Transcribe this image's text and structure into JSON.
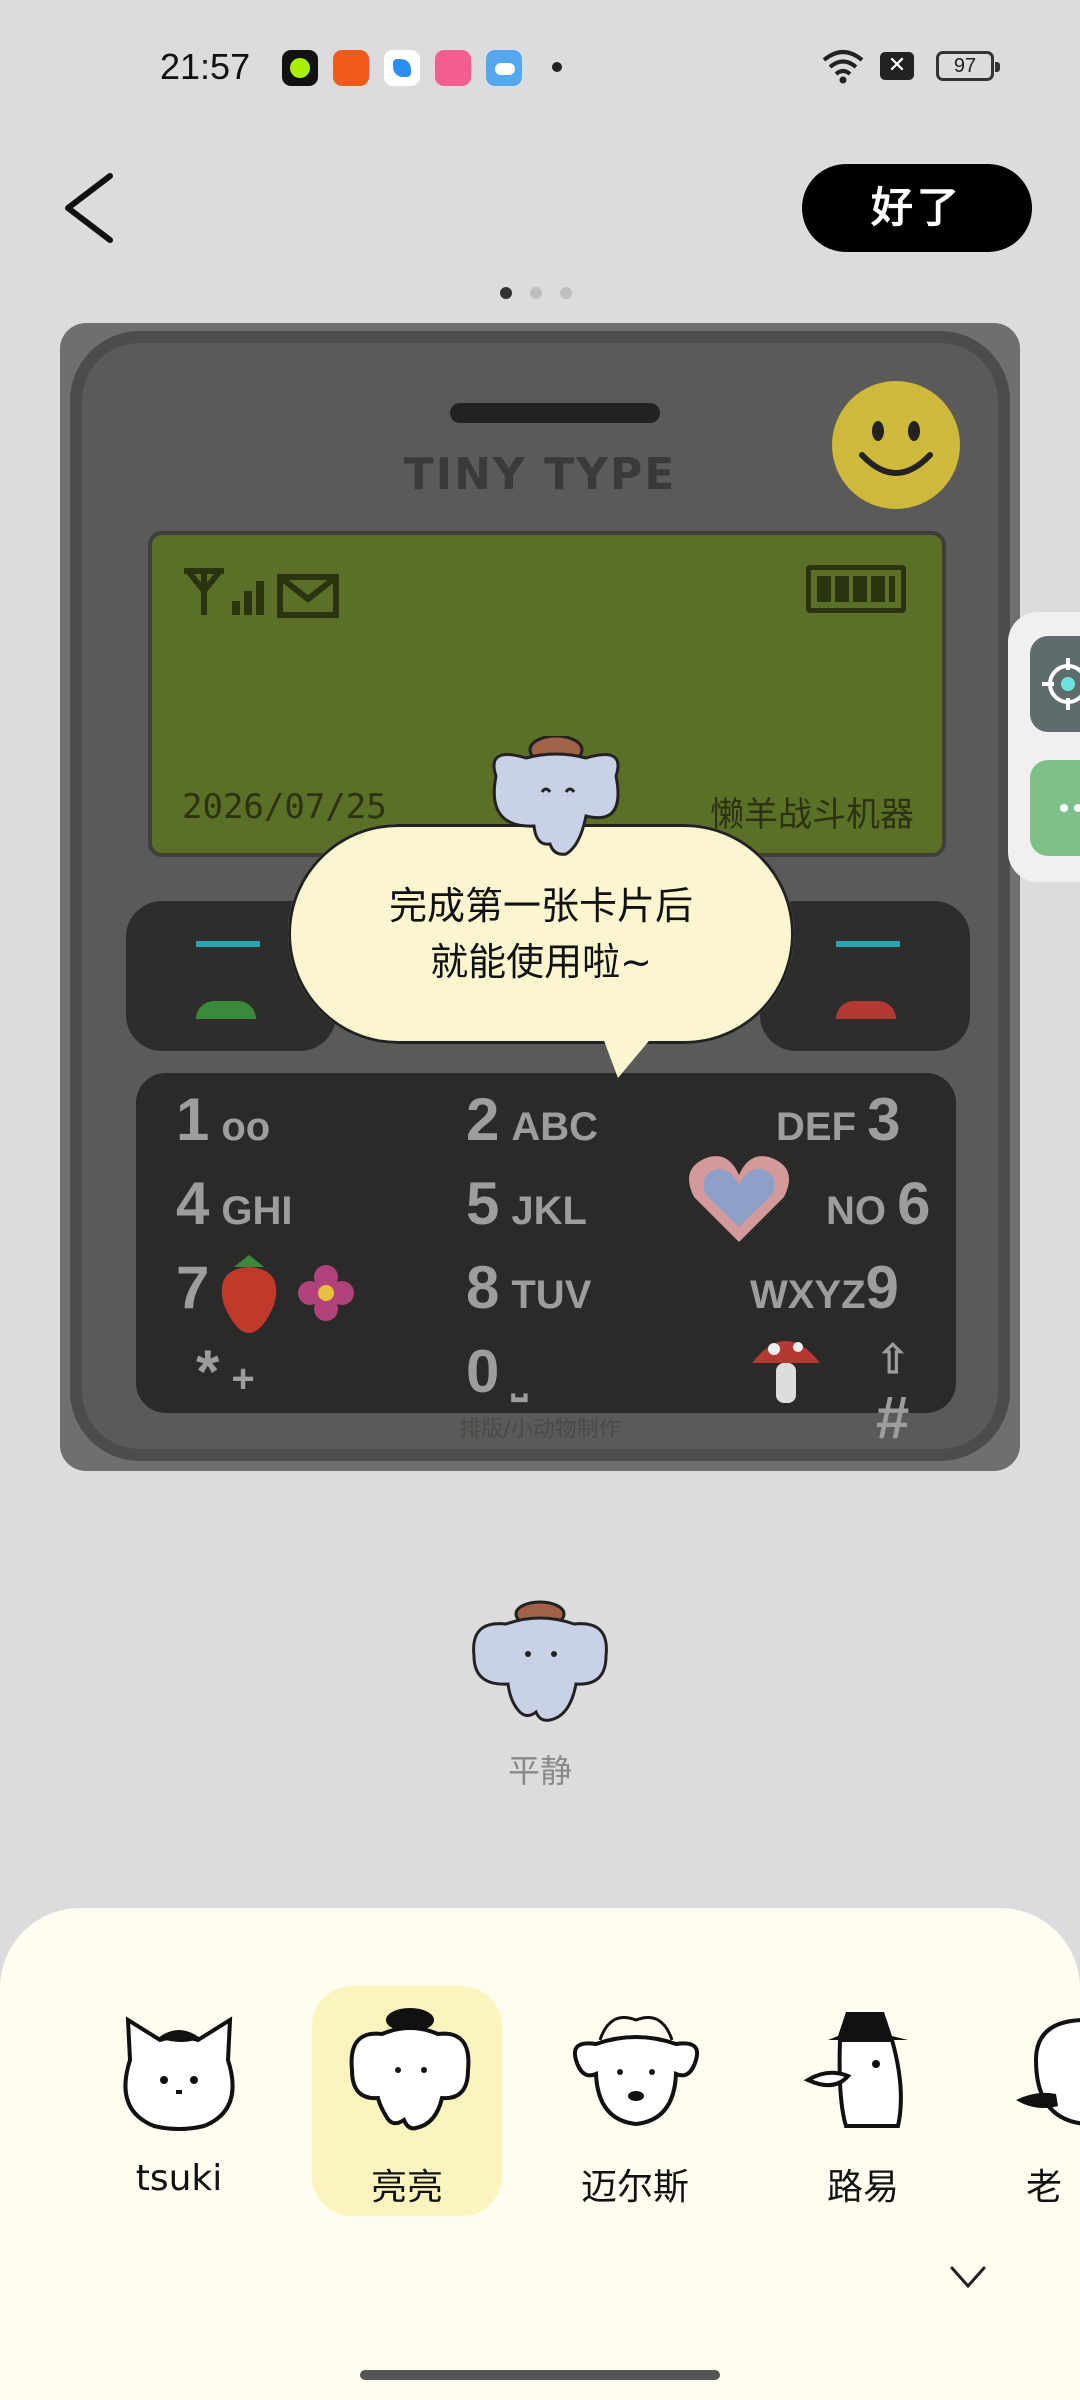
{
  "status_bar": {
    "time": "21:57",
    "battery": "97",
    "app_icons": [
      "green-dot-app-icon",
      "kuaishou-app-icon",
      "browser-app-icon",
      "bilibili-app-icon",
      "weather-app-icon"
    ]
  },
  "header": {
    "done_label": "好了",
    "pager_count": 3,
    "pager_active": 0
  },
  "preview": {
    "brand": "TINY TYPE",
    "date": "2026/07/25",
    "device_name": "懒羊战斗机器",
    "credit": "排版/小动物制作",
    "keys": [
      {
        "num": "1",
        "letters": ""
      },
      {
        "num": "2",
        "letters": "ABC"
      },
      {
        "num": "3",
        "letters": "DEF"
      },
      {
        "num": "4",
        "letters": "GHI"
      },
      {
        "num": "5",
        "letters": "JKL"
      },
      {
        "num": "6",
        "letters": "NO"
      },
      {
        "num": "7",
        "letters": ""
      },
      {
        "num": "8",
        "letters": "TUV"
      },
      {
        "num": "9",
        "letters": "WXYZ"
      },
      {
        "num": "*",
        "letters": "+"
      },
      {
        "num": "0",
        "letters": ""
      },
      {
        "num": "#",
        "letters": ""
      }
    ],
    "bubble_line1": "完成第一张卡片后",
    "bubble_line2": "就能使用啦~"
  },
  "mood": {
    "label": "平静"
  },
  "characters": [
    {
      "name": "tsuki"
    },
    {
      "name": "亮亮",
      "selected": true
    },
    {
      "name": "迈尔斯"
    },
    {
      "name": "路易"
    },
    {
      "name": "老"
    }
  ],
  "colors": {
    "background": "#dcdcde",
    "sheet": "#fffdf0",
    "selected_highlight": "#fcf4bf",
    "bubble": "#fbf6d0",
    "lcd": "#5b6f27"
  }
}
